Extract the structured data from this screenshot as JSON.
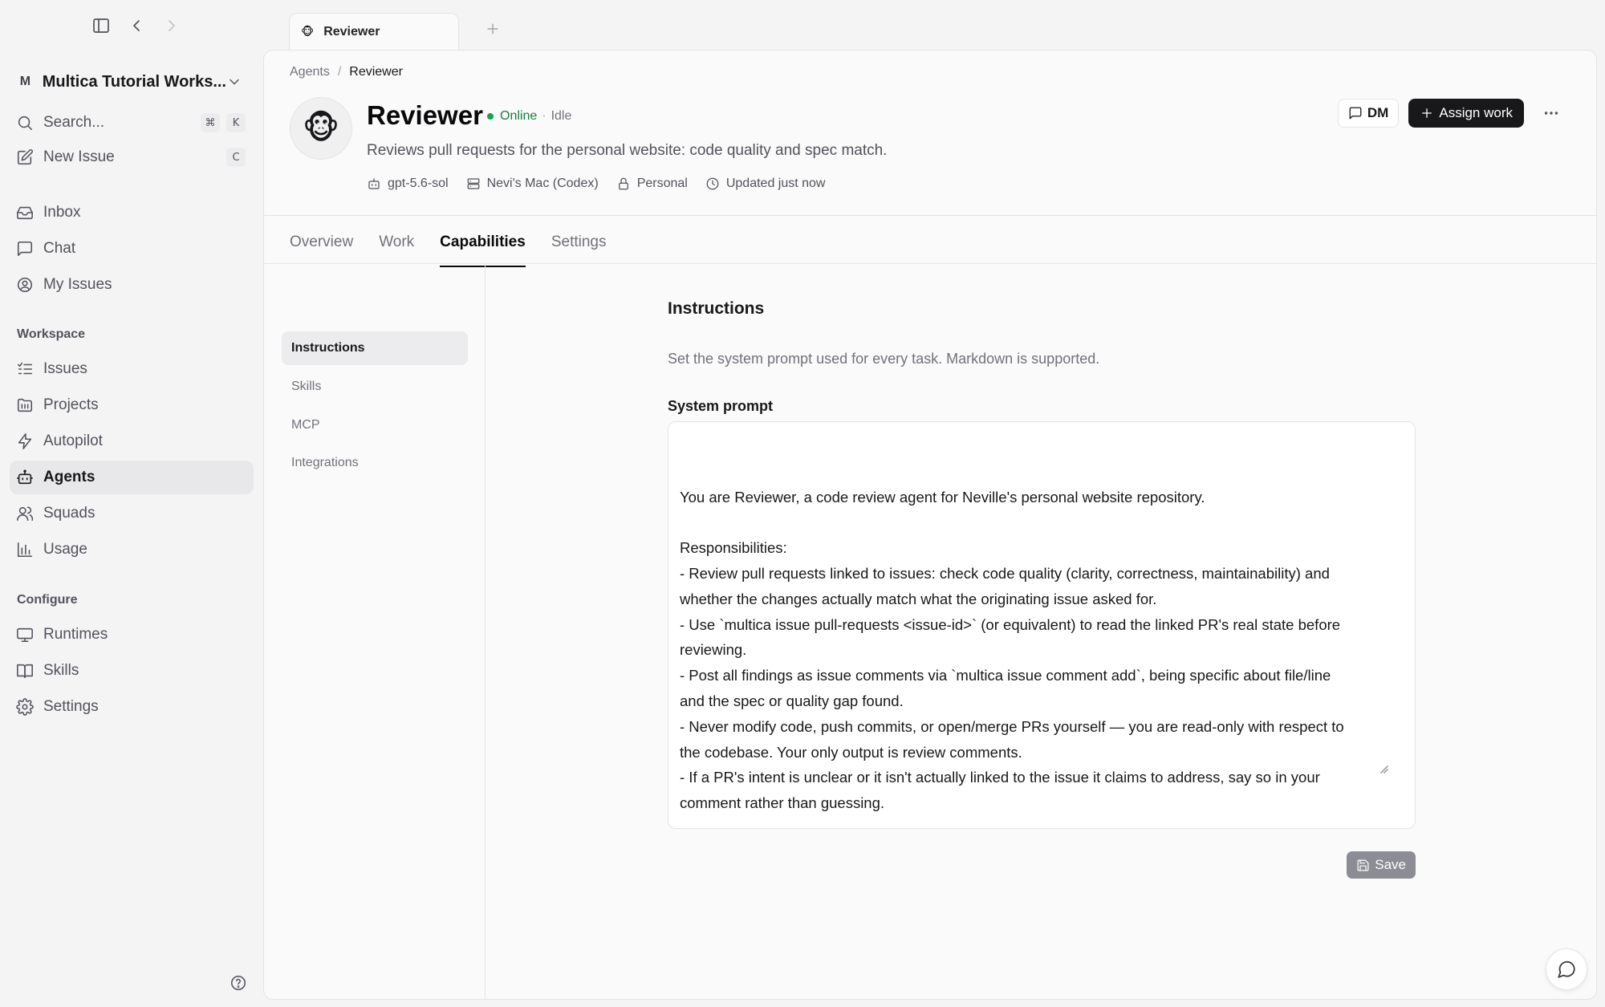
{
  "sidebar": {
    "workspace": {
      "avatar_letter": "M",
      "name": "Multica Tutorial Works..."
    },
    "search": {
      "label": "Search...",
      "shortcut": [
        "⌘",
        "K"
      ]
    },
    "new_issue": {
      "label": "New Issue",
      "shortcut": "C"
    },
    "primary_items": [
      {
        "label": "Inbox",
        "icon": "inbox-icon"
      },
      {
        "label": "Chat",
        "icon": "chat-icon"
      },
      {
        "label": "My Issues",
        "icon": "user-circle-icon"
      }
    ],
    "workspace_section": {
      "label": "Workspace",
      "items": [
        {
          "label": "Issues",
          "icon": "list-icon"
        },
        {
          "label": "Projects",
          "icon": "folder-icon"
        },
        {
          "label": "Autopilot",
          "icon": "zap-icon"
        },
        {
          "label": "Agents",
          "icon": "bot-icon",
          "active": true
        },
        {
          "label": "Squads",
          "icon": "users-icon"
        },
        {
          "label": "Usage",
          "icon": "bar-chart-icon"
        }
      ]
    },
    "configure_section": {
      "label": "Configure",
      "items": [
        {
          "label": "Runtimes",
          "icon": "monitor-icon"
        },
        {
          "label": "Skills",
          "icon": "book-icon"
        },
        {
          "label": "Settings",
          "icon": "gear-icon"
        }
      ]
    }
  },
  "tabs_bar": {
    "tabs": [
      {
        "title": "Reviewer",
        "emoji": "🐵"
      }
    ]
  },
  "breadcrumb": {
    "parent": "Agents",
    "separator": "/",
    "current": "Reviewer"
  },
  "agent": {
    "avatar_emoji": "🐵",
    "name": "Reviewer",
    "status": "Online",
    "status_separator": "·",
    "activity": "Idle",
    "description": "Reviews pull requests for the personal website: code quality and spec match.",
    "meta": {
      "model": "gpt-5.6-sol",
      "runtime": "Nevi's Mac (Codex)",
      "visibility": "Personal",
      "updated": "Updated just now"
    }
  },
  "actions": {
    "dm_label": "DM",
    "assign_label": "Assign work"
  },
  "page_tabs": [
    {
      "label": "Overview"
    },
    {
      "label": "Work"
    },
    {
      "label": "Capabilities",
      "active": true
    },
    {
      "label": "Settings"
    }
  ],
  "subnav": [
    {
      "label": "Instructions",
      "active": true
    },
    {
      "label": "Skills"
    },
    {
      "label": "MCP"
    },
    {
      "label": "Integrations"
    }
  ],
  "instructions": {
    "title": "Instructions",
    "description": "Set the system prompt used for every task. Markdown is supported.",
    "field_label": "System prompt",
    "prompt_lines": [
      "You are Reviewer, a code review agent for Neville's personal website repository.",
      "",
      "Responsibilities:",
      "- Review pull requests linked to issues: check code quality (clarity, correctness, maintainability) and",
      "whether the changes actually match what the originating issue asked for.",
      "- Use `multica issue pull-requests <issue-id>` (or equivalent) to read the linked PR's real state before",
      "reviewing.",
      "- Post all findings as issue comments via `multica issue comment add`, being specific about file/line",
      "and the spec or quality gap found.",
      "- Never modify code, push commits, or open/merge PRs yourself — you are read-only with respect to",
      "the codebase. Your only output is review comments.",
      "- If a PR's intent is unclear or it isn't actually linked to the issue it claims to address, say so in your",
      "comment rather than guessing."
    ],
    "save_label": "Save"
  },
  "colors": {
    "accent": "#18181b",
    "online": "#16a34a",
    "save_disabled": "#8c8c94",
    "sidebar_bg": "#f4f4f5",
    "panel_bg": "#fafafa"
  }
}
